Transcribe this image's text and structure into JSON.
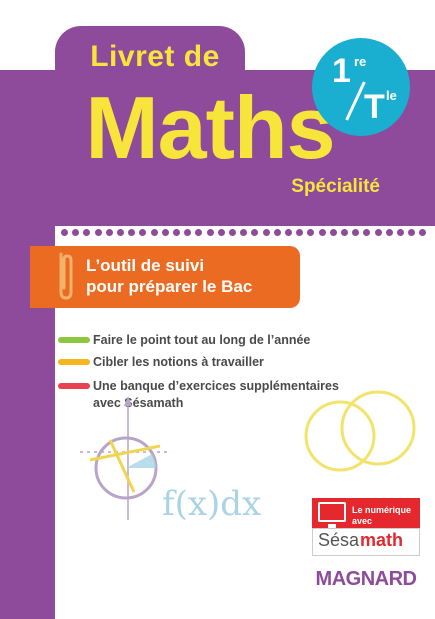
{
  "cover": {
    "title_line1": "Livret de",
    "title_main": "Maths",
    "subtitle": "Spécialité",
    "level": {
      "first_num": "1",
      "first_sup": "re",
      "second_num": "T",
      "second_sup": "le"
    },
    "banner": {
      "line1": "L’outil de suivi",
      "line2": "pour préparer le Bac"
    },
    "bullets": [
      {
        "text": "Faire le point tout au long de l’année",
        "color": "#8dc63f"
      },
      {
        "text": "Cibler les notions à travailler",
        "color": "#f6b621"
      },
      {
        "text": "Une banque d’exercices supplémentaires",
        "text2": "avec Sésamath",
        "color": "#e8414f"
      }
    ],
    "formula": "f(x)dx",
    "numeric": {
      "line1": "Le numérique",
      "line2": "avec",
      "brand_a": "Sésa",
      "brand_b": "math"
    },
    "publisher": "MAGNARD"
  },
  "colors": {
    "purple": "#8e4a9b",
    "yellow": "#f7e53b",
    "cyan": "#1aaed0",
    "orange": "#ec6b22",
    "red": "#e4282e"
  }
}
